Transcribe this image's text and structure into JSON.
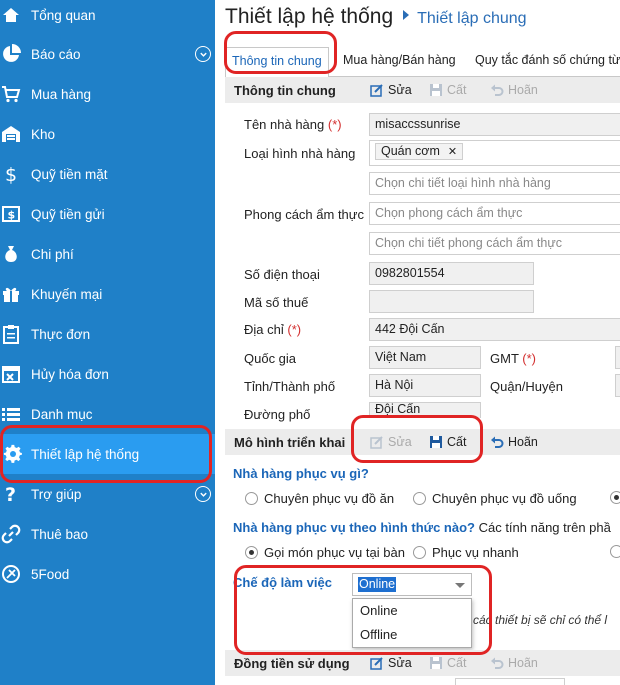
{
  "sidebar": {
    "bg_color": "#1f80c8",
    "active_color": "#2a9cf0",
    "items": [
      {
        "label": "Tổng quan",
        "icon": "home-icon"
      },
      {
        "label": "Báo cáo",
        "icon": "pie-chart-icon"
      },
      {
        "label": "Mua hàng",
        "icon": "cart-icon"
      },
      {
        "label": "Kho",
        "icon": "warehouse-icon"
      },
      {
        "label": "Quỹ tiền mặt",
        "icon": "dollar-icon"
      },
      {
        "label": "Quỹ tiền gửi",
        "icon": "bank-icon"
      },
      {
        "label": "Chi phí",
        "icon": "money-bag-icon"
      },
      {
        "label": "Khuyến mại",
        "icon": "gift-icon"
      },
      {
        "label": "Thực đơn",
        "icon": "clipboard-icon"
      },
      {
        "label": "Hủy hóa đơn",
        "icon": "calendar-cancel-icon"
      },
      {
        "label": "Danh mục",
        "icon": "list-icon"
      },
      {
        "label": "Thiết lập hệ thống",
        "icon": "gear-icon"
      },
      {
        "label": "Trợ giúp",
        "icon": "question-icon"
      },
      {
        "label": "Thuê bao",
        "icon": "link-icon"
      },
      {
        "label": "5Food",
        "icon": "5food-icon"
      }
    ]
  },
  "header": {
    "title": "Thiết lập hệ thống",
    "breadcrumb": "Thiết lập chung"
  },
  "tabs": [
    "Thông tin chung",
    "Mua hàng/Bán hàng",
    "Quy tắc đánh số chứng từ"
  ],
  "toolbar": {
    "edit": "Sửa",
    "save": "Cất",
    "cancel": "Hoãn"
  },
  "general": {
    "section_title": "Thông tin chung",
    "restaurant_name_label": "Tên nhà hàng",
    "restaurant_name": "misaccssunrise",
    "type_label": "Loại hình nhà hàng",
    "type_tag": "Quán cơm",
    "type_detail_placeholder": "Chọn chi tiết loại hình nhà hàng",
    "style_label": "Phong cách ẩm thực",
    "style_placeholder": "Chọn phong cách ẩm thực",
    "style_detail_placeholder": "Chọn chi tiết phong cách ẩm thực",
    "phone_label": "Số điện thoại",
    "phone": "0982801554",
    "tax_label": "Mã số thuế",
    "tax": "",
    "address_label": "Địa chỉ",
    "address": "442 Đội Cấn",
    "country_label": "Quốc gia",
    "country": "Việt Nam",
    "gmt_label": "GMT",
    "province_label": "Tỉnh/Thành phố",
    "province": "Hà Nội",
    "district_label": "Quận/Huyện",
    "street_label": "Đường phố",
    "street": "Đội Cấn",
    "required_mark": "(*)"
  },
  "deploy": {
    "section_title": "Mô hình triển khai",
    "q1": "Nhà hàng phục vụ gì?",
    "q1_options": [
      "Chuyên phục vụ đồ ăn",
      "Chuyên phục vụ đồ uống"
    ],
    "q2": "Nhà hàng phục vụ theo hình thức nào?",
    "q2_note": "Các tính năng trên phầ",
    "q2_options": [
      "Gọi món phục vụ tại bàn",
      "Phục vụ nhanh"
    ],
    "mode_label": "Chế độ làm việc",
    "mode_value": "Online",
    "mode_options": [
      "Online",
      "Offline"
    ],
    "mode_note": "các thiết bị sẽ chỉ có thể l"
  },
  "currency": {
    "section_title": "Đồng tiền sử dụng"
  },
  "annotation_color": "#e02424"
}
